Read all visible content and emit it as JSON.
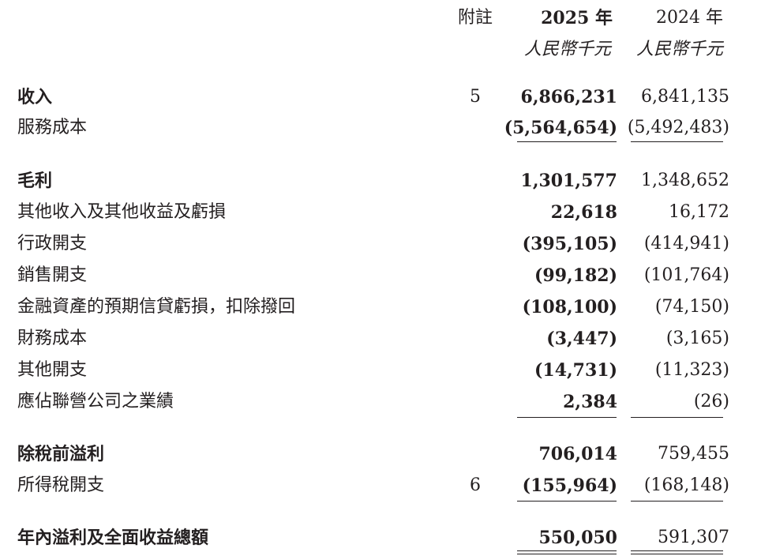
{
  "header": {
    "note_label": "附註",
    "year_current": "2025 年",
    "year_prior": "2024 年",
    "unit_current": "人民幣千元",
    "unit_prior": "人民幣千元"
  },
  "rows": [
    {
      "label": "收入",
      "bold": true,
      "note": "5",
      "current": "6,866,231",
      "prior": "6,841,135"
    },
    {
      "label": "服務成本",
      "bold": false,
      "note": "",
      "current": "(5,564,654)",
      "prior": "(5,492,483)"
    },
    {
      "label": "毛利",
      "bold": true,
      "note": "",
      "current": "1,301,577",
      "prior": "1,348,652"
    },
    {
      "label": "其他收入及其他收益及虧損",
      "bold": false,
      "note": "",
      "current": "22,618",
      "prior": "16,172"
    },
    {
      "label": "行政開支",
      "bold": false,
      "note": "",
      "current": "(395,105)",
      "prior": "(414,941)"
    },
    {
      "label": "銷售開支",
      "bold": false,
      "note": "",
      "current": "(99,182)",
      "prior": "(101,764)"
    },
    {
      "label": "金融資產的預期信貸虧損，扣除撥回",
      "bold": false,
      "note": "",
      "current": "(108,100)",
      "prior": "(74,150)"
    },
    {
      "label": "財務成本",
      "bold": false,
      "note": "",
      "current": "(3,447)",
      "prior": "(3,165)"
    },
    {
      "label": "其他開支",
      "bold": false,
      "note": "",
      "current": "(14,731)",
      "prior": "(11,323)"
    },
    {
      "label": "應佔聯營公司之業績",
      "bold": false,
      "note": "",
      "current": "2,384",
      "prior": "(26)"
    },
    {
      "label": "除稅前溢利",
      "bold": true,
      "note": "",
      "current": "706,014",
      "prior": "759,455"
    },
    {
      "label": "所得稅開支",
      "bold": false,
      "note": "6",
      "current": "(155,964)",
      "prior": "(168,148)"
    },
    {
      "label": "年內溢利及全面收益總額",
      "bold": true,
      "note": "",
      "current": "550,050",
      "prior": "591,307"
    }
  ]
}
